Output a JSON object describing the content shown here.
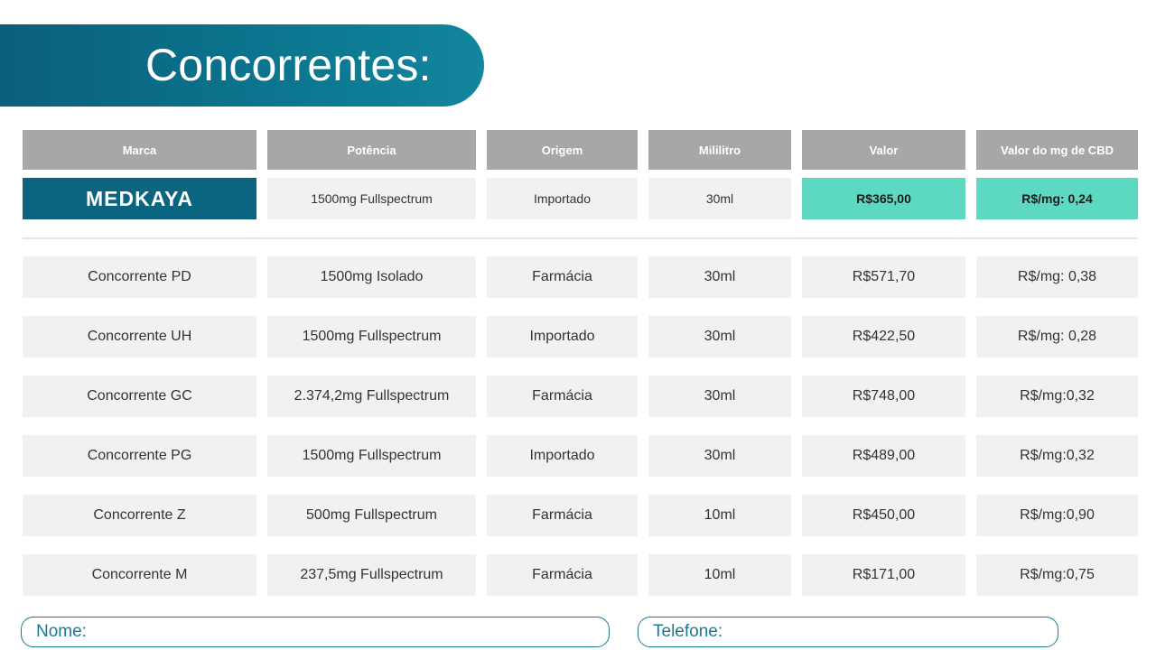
{
  "title": "Concorrentes:",
  "table": {
    "headers": [
      "Marca",
      "Potência",
      "Origem",
      "Mililitro",
      "Valor",
      "Valor do mg de CBD"
    ],
    "featured": {
      "marca": "MEDKAYA",
      "potencia": "1500mg Fullspectrum",
      "origem": "Importado",
      "mililitro": "30ml",
      "valor": "R$365,00",
      "valor_mg": "R$/mg: 0,24"
    },
    "rows": [
      {
        "marca": "Concorrente PD",
        "potencia": "1500mg Isolado",
        "origem": "Farmácia",
        "mililitro": "30ml",
        "valor": "R$571,70",
        "valor_mg": "R$/mg: 0,38"
      },
      {
        "marca": "Concorrente UH",
        "potencia": "1500mg Fullspectrum",
        "origem": "Importado",
        "mililitro": "30ml",
        "valor": "R$422,50",
        "valor_mg": "R$/mg: 0,28"
      },
      {
        "marca": "Concorrente GC",
        "potencia": "2.374,2mg Fullspectrum",
        "origem": "Farmácia",
        "mililitro": "30ml",
        "valor": "R$748,00",
        "valor_mg": "R$/mg:0,32"
      },
      {
        "marca": "Concorrente PG",
        "potencia": "1500mg Fullspectrum",
        "origem": "Importado",
        "mililitro": "30ml",
        "valor": "R$489,00",
        "valor_mg": "R$/mg:0,32"
      },
      {
        "marca": "Concorrente Z",
        "potencia": "500mg Fullspectrum",
        "origem": "Farmácia",
        "mililitro": "10ml",
        "valor": "R$450,00",
        "valor_mg": "R$/mg:0,90"
      },
      {
        "marca": "Concorrente M",
        "potencia": "237,5mg Fullspectrum",
        "origem": "Farmácia",
        "mililitro": "10ml",
        "valor": "R$171,00",
        "valor_mg": "R$/mg:0,75"
      }
    ]
  },
  "form": {
    "nome_label": "Nome:",
    "telefone_label": "Telefone:"
  },
  "colors": {
    "brand": "#0b6580",
    "highlight": "#5dd9c1",
    "header": "#a7a7a7",
    "cell": "#f1f1f1"
  }
}
